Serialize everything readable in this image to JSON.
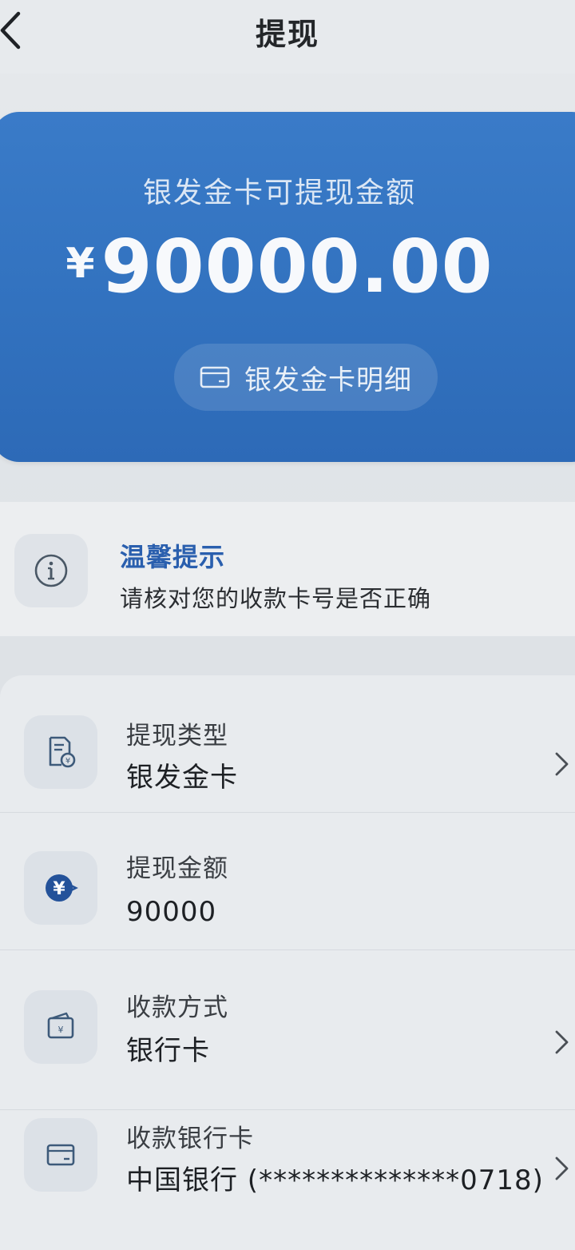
{
  "header": {
    "title": "提现",
    "back_icon": "chevron-left-icon"
  },
  "balance": {
    "label": "银发金卡可提现金额",
    "currency": "¥",
    "amount": "90000.00",
    "detail_button": "银发金卡明细",
    "card_color": "#3272bf"
  },
  "tip": {
    "title": "温馨提示",
    "text": "请核对您的收款卡号是否正确"
  },
  "form": {
    "rows": [
      {
        "label": "提现类型",
        "value": "银发金卡",
        "icon": "document-coin-icon"
      },
      {
        "label": "提现金额",
        "value": "90000",
        "icon": "yuan-coin-icon"
      },
      {
        "label": "收款方式",
        "value": "银行卡",
        "icon": "wallet-icon"
      },
      {
        "label": "收款银行卡",
        "value": "中国银行 (**************0718)",
        "icon": "card-icon"
      }
    ]
  }
}
